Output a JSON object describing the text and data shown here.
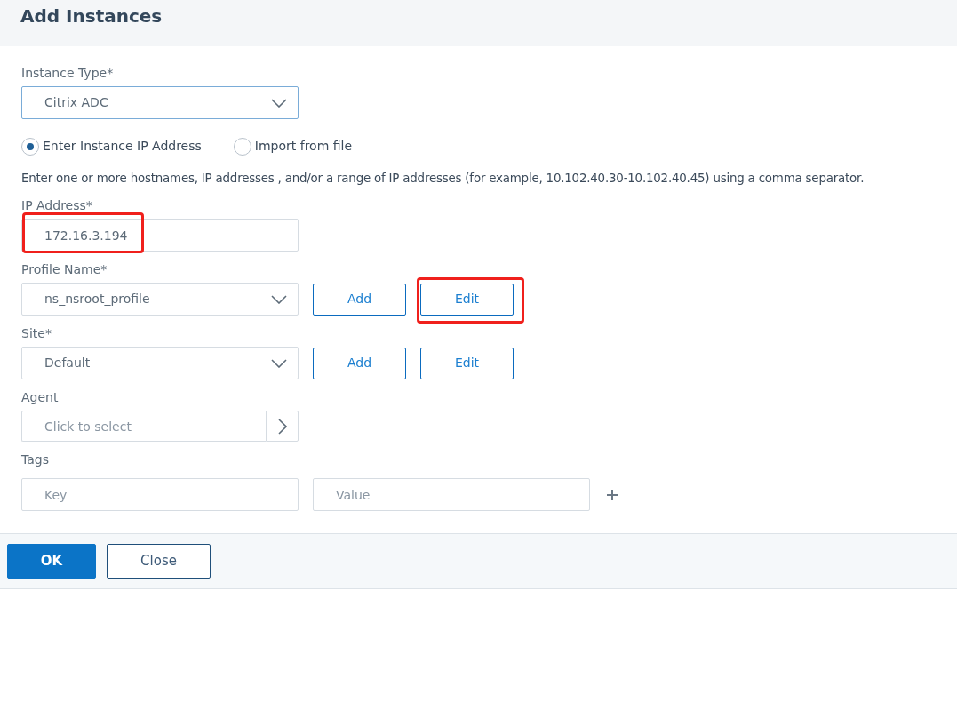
{
  "title": "Add Instances",
  "instance_type": {
    "label": "Instance Type*",
    "value": "Citrix ADC"
  },
  "source_options": [
    {
      "label": "Enter Instance IP Address",
      "selected": true
    },
    {
      "label": "Import from file",
      "selected": false
    }
  ],
  "hint": "Enter one or more hostnames, IP addresses , and/or a range of IP addresses (for example, 10.102.40.30-10.102.40.45) using a comma separator.",
  "ip_address": {
    "label": "IP Address*",
    "value": "172.16.3.194",
    "highlighted": true
  },
  "profile": {
    "label": "Profile Name*",
    "value": "ns_nsroot_profile",
    "buttons": [
      {
        "label": "Add",
        "highlighted": false
      },
      {
        "label": "Edit",
        "highlighted": true
      }
    ]
  },
  "site": {
    "label": "Site*",
    "value": "Default",
    "buttons": [
      {
        "label": "Add",
        "highlighted": false
      },
      {
        "label": "Edit",
        "highlighted": false
      }
    ]
  },
  "agent": {
    "label": "Agent",
    "placeholder": "Click to select"
  },
  "tags": {
    "label": "Tags",
    "key_placeholder": "Key",
    "value_placeholder": "Value"
  },
  "footer_buttons": [
    {
      "label": "OK",
      "kind": "primary"
    },
    {
      "label": "Close",
      "kind": "secondary"
    }
  ]
}
